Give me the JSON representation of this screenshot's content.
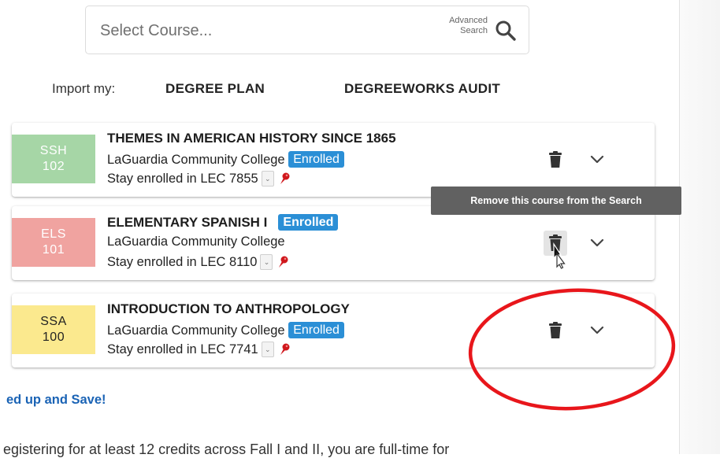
{
  "search": {
    "placeholder": "Select Course...",
    "advanced_line1": "Advanced",
    "advanced_line2": "Search"
  },
  "import": {
    "label": "Import my:",
    "degree_plan": "DEGREE PLAN",
    "degreeworks_audit": "DEGREEWORKS AUDIT"
  },
  "courses": [
    {
      "subject": "SSH",
      "number": "102",
      "title": "THEMES IN AMERICAN HISTORY SINCE 1865",
      "college": "LaGuardia Community College",
      "status": "Enrolled",
      "stay_text": "Stay enrolled in LEC 7855",
      "color_bg": "#a6d6a6",
      "color_text": "#ffffff"
    },
    {
      "subject": "ELS",
      "number": "101",
      "title": "ELEMENTARY SPANISH I",
      "college": "LaGuardia Community College",
      "status": "Enrolled",
      "stay_text": "Stay enrolled in LEC 8110",
      "color_bg": "#f0a3a0",
      "color_text": "#ffffff"
    },
    {
      "subject": "SSA",
      "number": "100",
      "title": "INTRODUCTION TO ANTHROPOLOGY",
      "college": "LaGuardia Community College",
      "status": "Enrolled",
      "stay_text": "Stay enrolled in LEC 7741",
      "color_bg": "#fbe98e",
      "color_text": "#222222"
    }
  ],
  "tooltip": {
    "text": "Remove this course from the Search"
  },
  "promo": {
    "heading": "ed up and Save!",
    "body": "egistering for at least 12 credits across Fall I and II, you are full-time for"
  },
  "colors": {
    "accent_blue": "#2b8fd6",
    "link_blue": "#1a63b5",
    "annotation_red": "#e8161b",
    "pin_red": "#d0171c"
  },
  "icons": {
    "search": "search-icon",
    "pin": "pushpin-icon",
    "trash": "trash-icon",
    "chevron": "chevron-down-icon",
    "cursor": "mouse-cursor-icon"
  }
}
